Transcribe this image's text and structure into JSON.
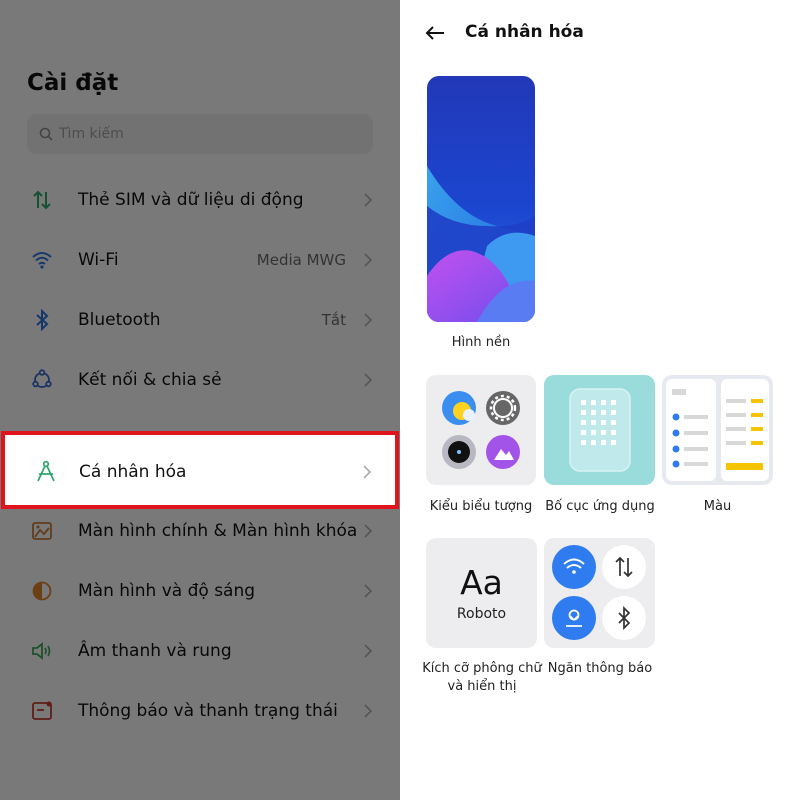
{
  "settings": {
    "title": "Cài đặt",
    "search_placeholder": "Tìm kiếm",
    "items": [
      {
        "label": "Thẻ SIM và dữ liệu di động",
        "value": ""
      },
      {
        "label": "Wi-Fi",
        "value": "Media MWG"
      },
      {
        "label": "Bluetooth",
        "value": "Tắt"
      },
      {
        "label": "Kết nối & chia sẻ",
        "value": ""
      },
      {
        "label": "Cá nhân hóa",
        "value": ""
      },
      {
        "label": "Màn hình chính & Màn hình khóa",
        "value": ""
      },
      {
        "label": "Màn hình và độ sáng",
        "value": ""
      },
      {
        "label": "Âm thanh và rung",
        "value": ""
      },
      {
        "label": "Thông báo và thanh trạng thái",
        "value": ""
      }
    ],
    "highlight_color": "#e0141c"
  },
  "personalize": {
    "title": "Cá nhân hóa",
    "wallpaper_label": "Hình nền",
    "icon_style_label": "Kiểu biểu tượng",
    "app_layout_label": "Bố cục ứng dụng",
    "color_label": "Màu",
    "font_label_line1": "Kích cỡ phông chữ",
    "font_label_line2": "và hiển thị",
    "notif_label": "Ngăn thông báo",
    "font_sample": "Aa",
    "font_name": "Roboto"
  },
  "colors": {
    "accent_green": "#2aa56b",
    "toggle_blue": "#2f7bf0",
    "color_yellow": "#f5c400"
  }
}
